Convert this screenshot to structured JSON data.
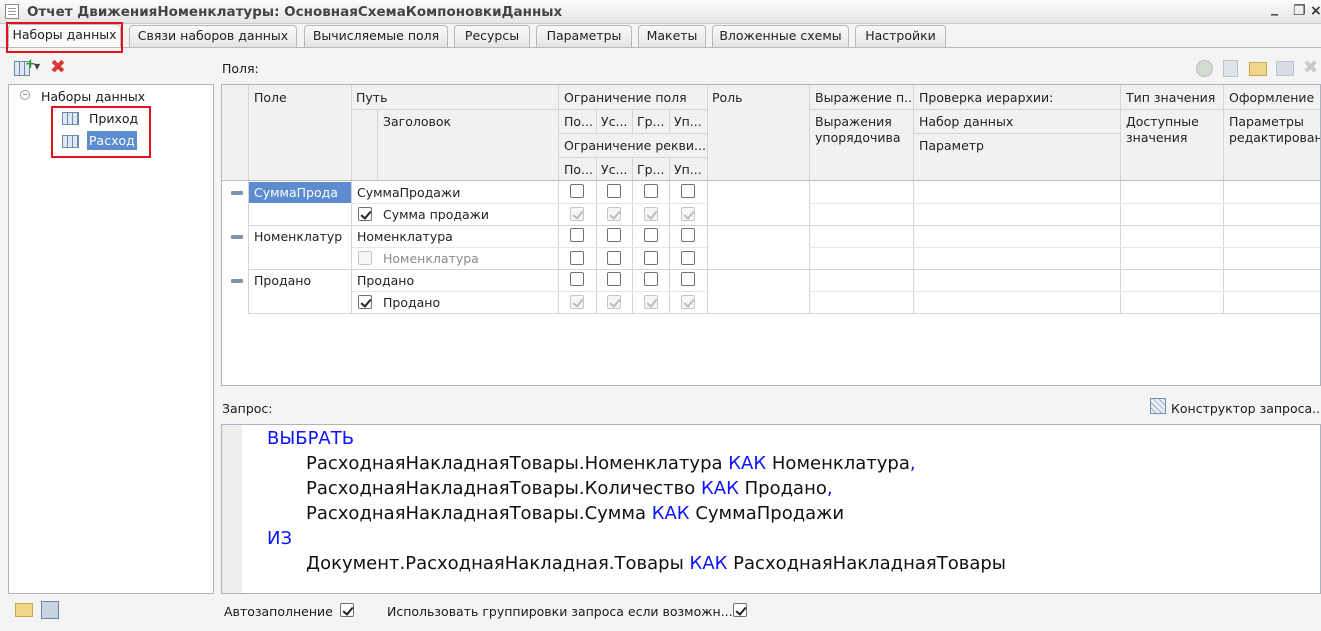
{
  "window": {
    "title": "Отчет ДвиженияНоменклатуры: ОсновнаяСхемаКомпоновкиДанных"
  },
  "tabs": [
    {
      "label": "Наборы данных"
    },
    {
      "label": "Связи наборов данных"
    },
    {
      "label": "Вычисляемые поля"
    },
    {
      "label": "Ресурсы"
    },
    {
      "label": "Параметры"
    },
    {
      "label": "Макеты"
    },
    {
      "label": "Вложенные схемы"
    },
    {
      "label": "Настройки"
    }
  ],
  "tree": {
    "root": "Наборы данных",
    "items": [
      "Приход",
      "Расход"
    ],
    "selected": "Расход"
  },
  "fields_label": "Поля:",
  "grid": {
    "headers": {
      "field": "Поле",
      "path": "Путь",
      "title": "Заголовок",
      "restriction": "Ограничение поля",
      "r1": "По...",
      "r2": "Ус...",
      "r3": "Гр...",
      "r4": "Уп...",
      "restriction_attr": "Ограничение рекви...",
      "a1": "По...",
      "a2": "Ус...",
      "a3": "Гр...",
      "a4": "Уп...",
      "role": "Роль",
      "expr": "Выражение п...",
      "order_expr": "Выражения упорядочива",
      "hier": "Проверка иерархии:",
      "hier_set": "Набор данных",
      "hier_param": "Параметр",
      "value_type": "Тип значения",
      "avail_values": "Доступные значения",
      "format": "Оформление",
      "edit_params": "Параметры редактирован"
    },
    "rows": [
      {
        "field": "СуммаПрода",
        "path": "СуммаПродажи",
        "title": "Сумма продажи",
        "title_checked": true,
        "title_enabled": true,
        "selected": true
      },
      {
        "field": "Номенклатур",
        "path": "Номенклатура",
        "title": "Номенклатура",
        "title_checked": false,
        "title_enabled": false,
        "selected": false
      },
      {
        "field": "Продано",
        "path": "Продано",
        "title": "Продано",
        "title_checked": true,
        "title_enabled": true,
        "selected": false
      }
    ]
  },
  "query_label": "Запрос:",
  "query_designer": "Конструктор запроса...",
  "query": {
    "select_kw": "ВЫБРАТЬ",
    "l1_expr": "РасходнаяНакладнаяТовары.Номенклатура",
    "l1_kw": "КАК",
    "l1_alias": "Номенклатура",
    "l2_expr": "РасходнаяНакладнаяТовары.Количество",
    "l2_kw": "КАК",
    "l2_alias": "Продано",
    "l3_expr": "РасходнаяНакладнаяТовары.Сумма",
    "l3_kw": "КАК",
    "l3_alias": "СуммаПродажи",
    "from_kw": "ИЗ",
    "l4_expr": "Документ.РасходнаяНакладная.Товары",
    "l4_kw": "КАК",
    "l4_alias": "РасходнаяНакладнаяТовары",
    "comma": ","
  },
  "bottom": {
    "autofill": "Автозаполнение",
    "autofill_checked": true,
    "use_grouping": "Использовать группировки запроса если возможн...",
    "use_grouping_checked": true
  },
  "colors": {
    "accent_red": "#e0121b",
    "keyword_blue": "#0b14ff",
    "selection": "#5c8bd0"
  }
}
